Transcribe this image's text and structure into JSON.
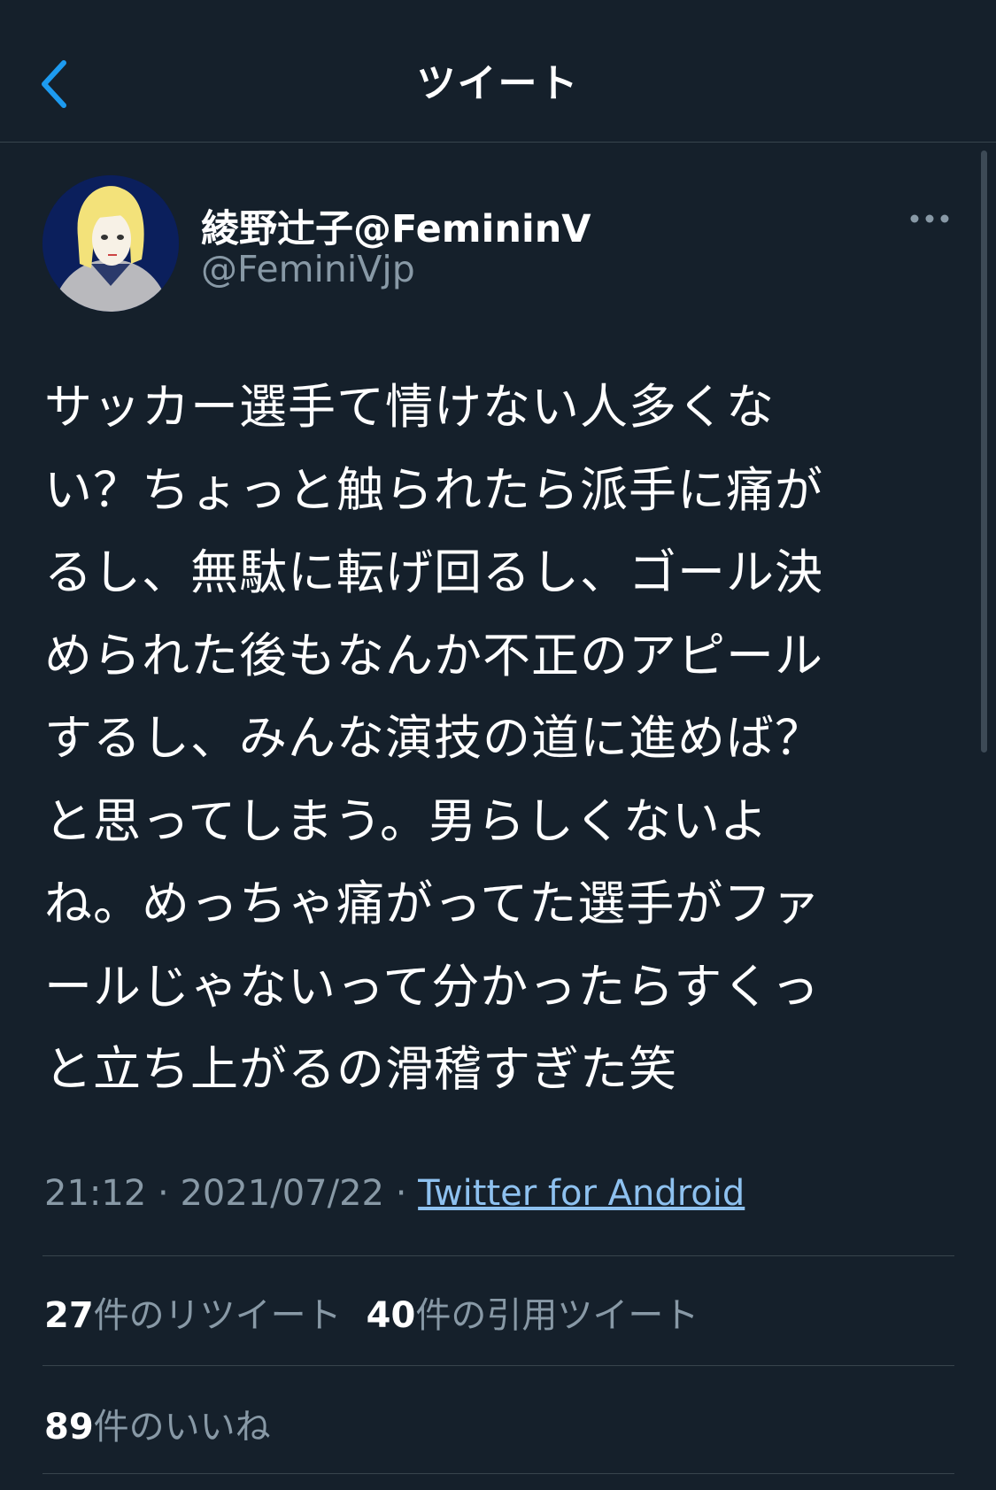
{
  "header": {
    "title": "ツイート",
    "back_icon": "chevron-left-icon",
    "accent_color": "#1d9bf0"
  },
  "author": {
    "display_name": "綾野辻子@FemininV",
    "handle": "@FeminiVjp",
    "avatar_icon": "avatar-illustration"
  },
  "tweet": {
    "lines": [
      "サッカー選手て情けない人多くな",
      "い？ちょっと触られたら派手に痛が",
      "るし、無駄に転げ回るし、ゴール決",
      "められた後もなんか不正のアピール",
      "するし、みんな演技の道に進めば？",
      "と思ってしまう。男らしくないよ",
      "ね。めっちゃ痛がってた選手がファ",
      "ールじゃないって分かったらすくっ",
      "と立ち上がるの滑稽すぎた笑"
    ]
  },
  "meta": {
    "time": "21:12",
    "separator": " · ",
    "date": "2021/07/22",
    "source": "Twitter for Android"
  },
  "stats": {
    "retweets_count": "27",
    "retweets_label": "件のリツイート",
    "quotes_count": "40",
    "quotes_label": "件の引用ツイート",
    "likes_count": "89",
    "likes_label": "件のいいね"
  },
  "colors": {
    "background": "#15202b",
    "divider": "#38444d",
    "secondary_text": "#8899a6",
    "link": "#8ec1ef"
  }
}
